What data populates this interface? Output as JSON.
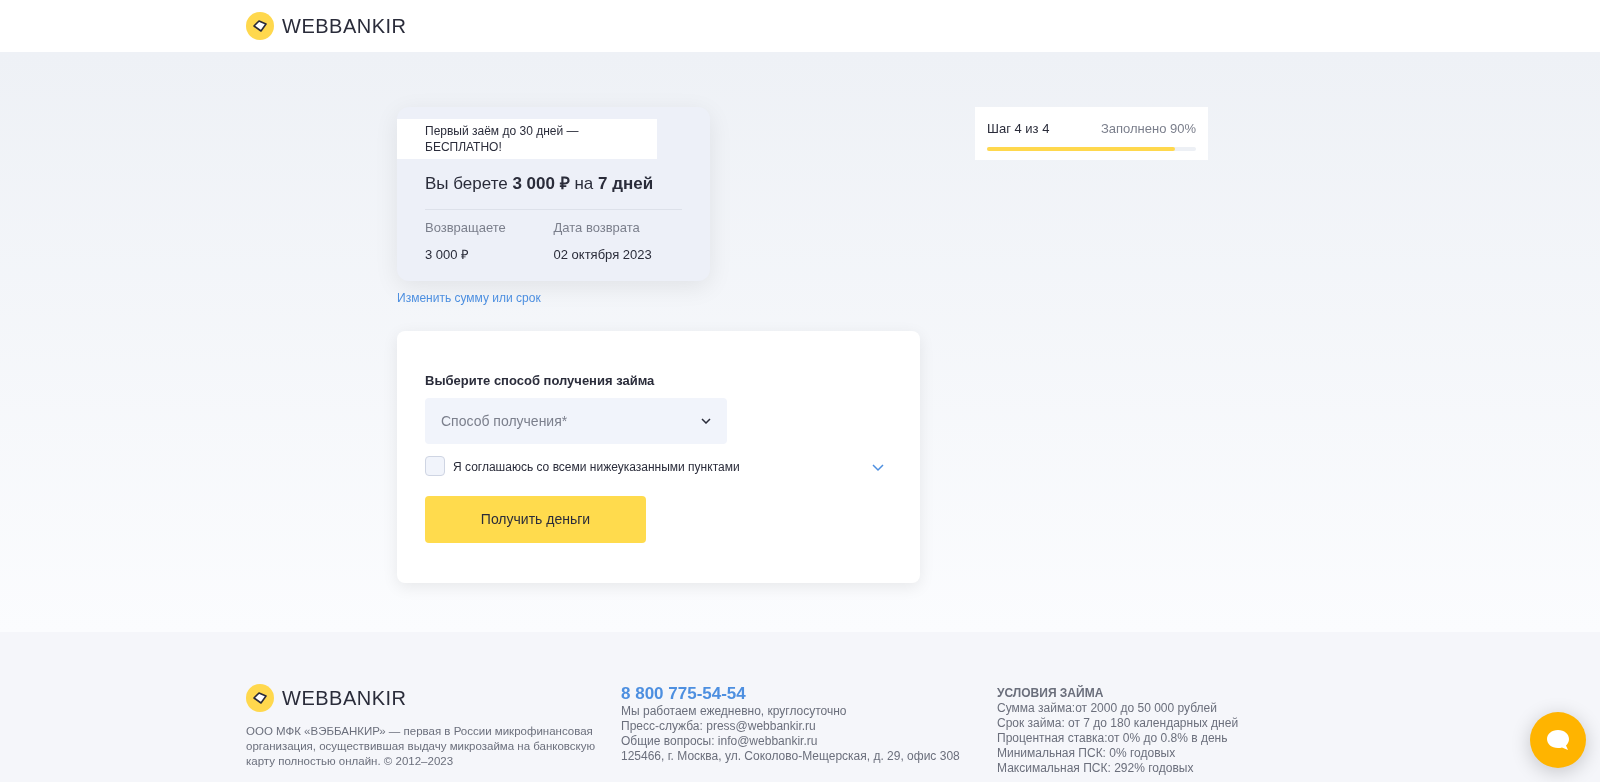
{
  "header": {
    "logo_text": "WEBBANKIR"
  },
  "loan_summary": {
    "promo": "Первый заём до 30 дней — БЕСПЛАТНО!",
    "headline": "Вы берете **3 000 ₽** на **7 дней**",
    "return_label": "Возвращаете",
    "return_value": "3 000 ₽",
    "date_label": "Дата возврата",
    "date_value": "02 октября 2023"
  },
  "change_link": "Изменить сумму или срок",
  "progress": {
    "step": "Шаг 4 из 4",
    "filled": "Заполнено 90%",
    "level": 0.9
  },
  "form": {
    "title": "Выберите способ получения займа",
    "method_select": {
      "placeholder": "Способ получения*"
    },
    "agree": {
      "label": "Я соглашаюсь со всеми нижеуказанными пунктами",
      "checked": false,
      "expanded": false
    },
    "submit": "Получить деньги"
  },
  "footer": {
    "logo_text": "WEBBANKIR",
    "about": "ООО МФК «ВЭББАНКИР» — первая в России микрофинансовая организация, осуществившая выдачу микрозайма на банковскую карту полностью онлайн. © 2012–2023",
    "phone": "8 800 775-54-54",
    "contacts": [
      "Мы работаем ежедневно, круглосуточно",
      "Пресс-служба: press@webbankir.ru",
      "Общие вопросы: info@webbankir.ru",
      "125466, г. Москва, ул. Соколово-Мещерская, д. 29, офис 308"
    ],
    "terms_title": "УСЛОВИЯ ЗАЙМА",
    "terms": [
      "Сумма займа:от 2000 до 50 000 рублей",
      "Срок займа: от 7 до 180 календарных дней",
      "Процентная ставка:от 0% до 0.8% в день",
      "Минимальная ПСК: 0% годовых",
      "Максимальная ПСК: 292% годовых"
    ]
  }
}
